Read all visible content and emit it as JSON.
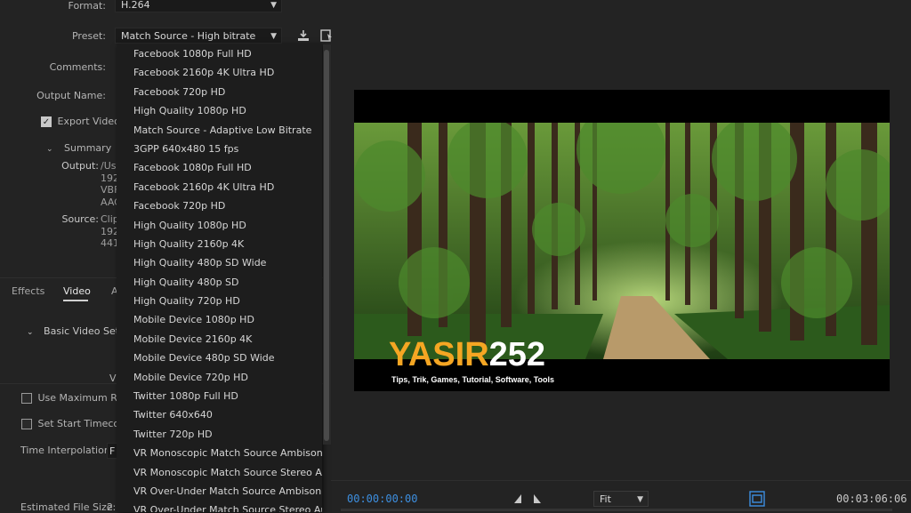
{
  "settings": {
    "format_label": "Format:",
    "format_value": "H.264",
    "preset_label": "Preset:",
    "preset_value": "Match Source - High bitrate",
    "comments_label": "Comments:",
    "output_name_label": "Output Name:",
    "export_video_label": "Export Video",
    "summary_label": "Summary",
    "output_label": "Output:",
    "output_lines": [
      "/Us",
      "192",
      "VBF",
      "AAC"
    ],
    "source_label": "Source:",
    "source_lines": [
      "Clip",
      "192",
      "441"
    ]
  },
  "tabs": [
    "Effects",
    "Video",
    "A"
  ],
  "video_settings": {
    "basic_label": "Basic Video Setti",
    "v_label": "V",
    "use_max_render": "Use Maximum Ren",
    "set_start_timecode": "Set Start Timecode",
    "time_interpolation_label": "Time Interpolation:",
    "time_interp_value": "F",
    "estimated_size_label": "Estimated File Size:",
    "estimated_size_value": "2"
  },
  "dropdown_items": [
    "Facebook 1080p Full HD",
    "Facebook 2160p 4K Ultra HD",
    "Facebook 720p HD",
    "High Quality 1080p HD",
    "Match Source - Adaptive Low Bitrate",
    "3GPP 640x480 15 fps",
    "Facebook 1080p Full HD",
    "Facebook 2160p 4K Ultra HD",
    "Facebook 720p HD",
    "High Quality 1080p HD",
    "High Quality 2160p 4K",
    "High Quality 480p SD Wide",
    "High Quality 480p SD",
    "High Quality 720p HD",
    "Mobile Device 1080p HD",
    "Mobile Device 2160p 4K",
    "Mobile Device 480p SD Wide",
    "Mobile Device 720p HD",
    "Twitter 1080p Full HD",
    "Twitter 640x640",
    "Twitter 720p HD",
    "VR Monoscopic Match Source Ambisonics",
    "VR Monoscopic Match Source Stereo Audio",
    "VR Over-Under Match Source Ambisonics",
    "VR Over-Under Match Source Stereo Audio"
  ],
  "preview": {
    "watermark_main": "YASIR",
    "watermark_num": "252",
    "watermark_sub": "Tips, Trik, Games, Tutorial, Software, Tools"
  },
  "playback": {
    "current_timecode": "00:00:00:00",
    "fit_value": "Fit",
    "duration_timecode": "00:03:06:06"
  },
  "colors": {
    "accent_blue": "#3d8fe0",
    "watermark_orange": "#f5a623"
  }
}
